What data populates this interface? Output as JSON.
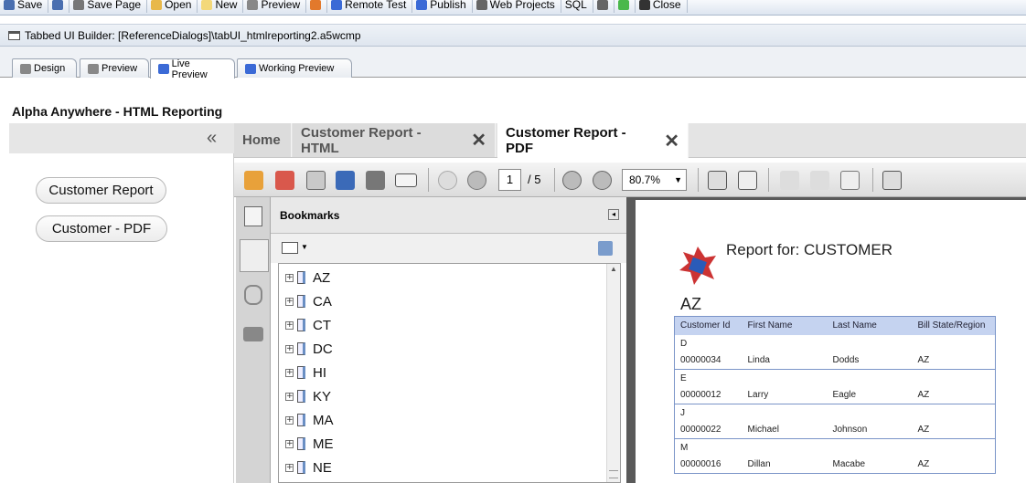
{
  "toolbar": {
    "items": [
      {
        "label": "Save",
        "icon": "floppy-icon"
      },
      {
        "label": "",
        "icon": "save-as-icon"
      },
      {
        "label": "Save Page",
        "icon": "save-page-icon"
      },
      {
        "label": "Open",
        "icon": "folder-open-icon"
      },
      {
        "label": "New",
        "icon": "new-file-icon"
      },
      {
        "label": "Preview",
        "icon": "preview-icon"
      },
      {
        "label": "",
        "icon": "browser-icon"
      },
      {
        "label": "Remote Test",
        "icon": "lightning-icon"
      },
      {
        "label": "Publish",
        "icon": "publish-icon"
      },
      {
        "label": "Web Projects",
        "icon": "web-projects-icon"
      },
      {
        "label": "SQL",
        "icon": ""
      },
      {
        "label": "",
        "icon": "font-icon"
      },
      {
        "label": "",
        "icon": "green-ball-icon"
      },
      {
        "label": "Close",
        "icon": "x-icon"
      }
    ]
  },
  "window": {
    "title": "Tabbed UI Builder: [ReferenceDialogs]\\tabUI_htmlreporting2.a5wcmp"
  },
  "mode_tabs": [
    "Design",
    "Preview",
    "Live Preview",
    "Working Preview"
  ],
  "app": {
    "title": "Alpha Anywhere - HTML Reporting",
    "collapse_glyph": "«",
    "buttons": [
      "Customer Report",
      "Customer - PDF"
    ]
  },
  "doc_tabs": [
    "Home",
    "Customer Report - HTML",
    "Customer Report - PDF"
  ],
  "pdf": {
    "page": "1",
    "total": "/ 5",
    "zoom": "80.7%"
  },
  "bookmarks": {
    "title": "Bookmarks",
    "items": [
      "AZ",
      "CA",
      "CT",
      "DC",
      "HI",
      "KY",
      "MA",
      "ME",
      "NE"
    ]
  },
  "report": {
    "title": "Report for: CUSTOMER",
    "region": "AZ",
    "columns": [
      "Customer Id",
      "First Name",
      "Last Name",
      "Bill State/Region"
    ],
    "groups": [
      {
        "letter": "D",
        "row": [
          "00000034",
          "Linda",
          "Dodds",
          "AZ"
        ]
      },
      {
        "letter": "E",
        "row": [
          "00000012",
          "Larry",
          "Eagle",
          "AZ"
        ]
      },
      {
        "letter": "J",
        "row": [
          "00000022",
          "Michael",
          "Johnson",
          "AZ"
        ]
      },
      {
        "letter": "M",
        "row": [
          "00000016",
          "Dillan",
          "Macabe",
          "AZ"
        ]
      }
    ]
  },
  "colors": {
    "accent": "#c5d3f0",
    "toolbar": "#dde5f0",
    "viewer_bg": "#5a5a5a"
  }
}
